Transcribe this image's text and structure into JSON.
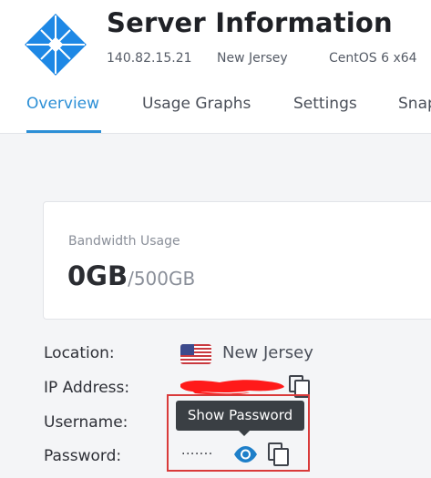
{
  "header": {
    "title": "Server Information",
    "ip": "140.82.15.21",
    "location": "New Jersey",
    "os": "CentOS 6 x64",
    "logo_color": "#1e88e5"
  },
  "tabs": [
    {
      "label": "Overview",
      "active": true
    },
    {
      "label": "Usage Graphs",
      "active": false
    },
    {
      "label": "Settings",
      "active": false
    },
    {
      "label": "Snap",
      "active": false
    }
  ],
  "bandwidth": {
    "label": "Bandwidth Usage",
    "used": "0GB",
    "total": "/500GB"
  },
  "details": {
    "location_label": "Location:",
    "location_value": "New Jersey",
    "ip_label": "IP Address:",
    "username_label": "Username:",
    "password_label": "Password:",
    "password_masked": "·······"
  },
  "tooltip": {
    "text": "Show Password"
  },
  "colors": {
    "accent": "#2c8fd6",
    "highlight_border": "#d93a3a",
    "redaction": "#ff1a1a",
    "tooltip_bg": "#3a3f44"
  },
  "icons": {
    "copy": "copy-icon",
    "show_password": "eye-icon",
    "flag": "us-flag-icon"
  }
}
